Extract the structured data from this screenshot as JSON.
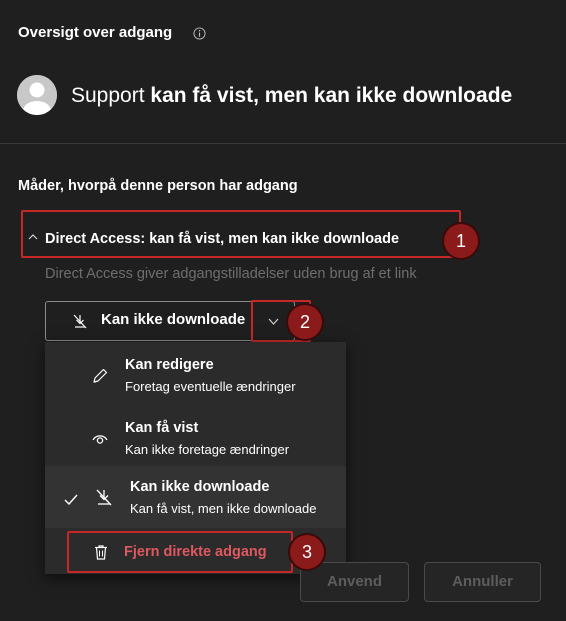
{
  "panel": {
    "title": "Oversigt over adgang"
  },
  "subject": {
    "name": "Support",
    "permission_text": "kan få vist, men kan ikke downloade"
  },
  "section": {
    "heading": "Måder, hvorpå denne person har adgang"
  },
  "access": {
    "header": "Direct Access: kan få vist, men kan ikke downloade",
    "description": "Direct Access giver adgangstilladelser uden brug af et link"
  },
  "permission_dropdown": {
    "selected_label": "Kan ikke downloade"
  },
  "menu": {
    "items": [
      {
        "title": "Kan redigere",
        "subtitle": "Foretag eventuelle ændringer",
        "icon": "pencil-icon"
      },
      {
        "title": "Kan få vist",
        "subtitle": "Kan ikke foretage ændringer",
        "icon": "eye-icon"
      },
      {
        "title": "Kan ikke downloade",
        "subtitle": "Kan få vist, men ikke downloade",
        "icon": "no-download-icon",
        "selected": true
      }
    ],
    "remove_label": "Fjern direkte adgang"
  },
  "badges": [
    "1",
    "2",
    "3"
  ],
  "buttons": {
    "apply": "Anvend",
    "cancel": "Annuller"
  },
  "colors": {
    "background": "#1f1f1f",
    "highlight_border": "#c62828",
    "badge": "#8b1a1a",
    "danger_text": "#e0585f"
  }
}
